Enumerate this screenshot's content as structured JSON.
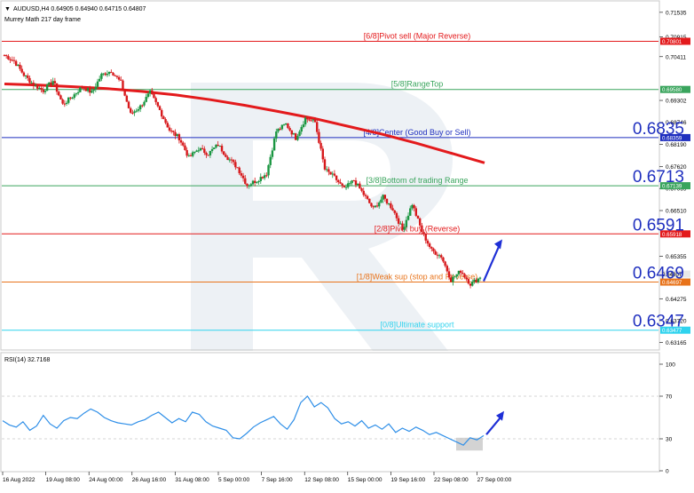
{
  "header": {
    "symbol_line": "AUDUSD,H4  0.64905 0.64940 0.64715 0.64807",
    "indicator_name": "Murrey Math 217 day frame"
  },
  "colors": {
    "bull": "#1a9641",
    "bear": "#d7191c",
    "ma": "#e31a1c",
    "rsi": "#2f8fe8",
    "arrow": "#1e2fd6",
    "watermark": "#dfe6ec"
  },
  "chart_data": [
    {
      "type": "candlestick",
      "title": "",
      "y_axis_ticks": [
        "0.71535",
        "0.70915",
        "0.70411",
        "0.69302",
        "0.68746",
        "0.68190",
        "0.67620",
        "0.67069",
        "0.66510",
        "0.65355",
        "0.64275",
        "0.63720",
        "0.63165"
      ],
      "ylim": [
        0.6302,
        0.7178
      ],
      "x_tick_labels": [
        "16 Aug 2022",
        "19 Aug 08:00",
        "24 Aug 00:00",
        "26 Aug 16:00",
        "31 Aug 08:00",
        "5 Sep 00:00",
        "7 Sep 16:00",
        "12 Sep 08:00",
        "15 Sep 00:00",
        "19 Sep 16:00",
        "22 Sep 08:00",
        "27 Sep 00:00"
      ],
      "murrey_levels": [
        {
          "label": "[6/8]Pivot sell (Major Reverse)",
          "value": 0.70801,
          "axis_badge": "0.70801",
          "big_label": "",
          "color": "#e31a1c"
        },
        {
          "label": "[5/8]RangeTop",
          "value": 0.6958,
          "axis_badge": "0.69580",
          "big_label": "",
          "color": "#3aa55d"
        },
        {
          "label": "[4/8]Center (Good Buy or Sell)",
          "value": 0.68359,
          "axis_badge": "0.68359",
          "big_label": "0.6835",
          "color": "#1f2fbf"
        },
        {
          "label": "[3/8]Bottom of trading Range",
          "value": 0.67139,
          "axis_badge": "0.67139",
          "big_label": "0.6713",
          "color": "#3aa55d"
        },
        {
          "label": "[2/8]Pivot buy (Reverse)",
          "value": 0.65918,
          "axis_badge": "0.65918",
          "big_label": "0.6591",
          "color": "#e31a1c"
        },
        {
          "label": "[1/8]Weak sup (stop and Reverse)",
          "value": 0.64697,
          "axis_badge": "0.64697",
          "big_label": "0.6469",
          "color": "#e8731a"
        },
        {
          "label": "[0/8]Ultimate support",
          "value": 0.63477,
          "axis_badge": "0.63477",
          "big_label": "0.6347",
          "color": "#2fd3ee"
        }
      ],
      "current_price_badge": "0.64807",
      "current_price": 0.64807,
      "price_path": [
        0.7045,
        0.703,
        0.6995,
        0.697,
        0.6955,
        0.698,
        0.692,
        0.694,
        0.6965,
        0.695,
        0.6995,
        0.7005,
        0.6975,
        0.6895,
        0.6915,
        0.695,
        0.6905,
        0.6855,
        0.6835,
        0.6785,
        0.6808,
        0.6795,
        0.6818,
        0.6785,
        0.676,
        0.6715,
        0.6728,
        0.6745,
        0.6852,
        0.687,
        0.6835,
        0.6885,
        0.6875,
        0.6755,
        0.6735,
        0.6705,
        0.6728,
        0.6692,
        0.6655,
        0.6685,
        0.6655,
        0.6602,
        0.6668,
        0.6598,
        0.655,
        0.6535,
        0.6475,
        0.6498,
        0.6465,
        0.6481
      ],
      "moving_average": [
        0.6972,
        0.6969,
        0.6965,
        0.696,
        0.6953,
        0.6944,
        0.6932,
        0.6918,
        0.6902,
        0.6885,
        0.6865,
        0.6845,
        0.6822,
        0.6797,
        0.6772
      ],
      "arrow": {
        "from": 0.6472,
        "to": 0.6578
      }
    },
    {
      "type": "line",
      "title": "RSI(14) 32.7168",
      "y_axis_ticks": [
        "100",
        "70",
        "30",
        "0"
      ],
      "ylim": [
        0,
        100
      ],
      "hlines": [
        70,
        30
      ],
      "values": [
        47,
        43,
        41,
        46,
        38,
        42,
        52,
        44,
        40,
        47,
        50,
        49,
        54,
        58,
        55,
        50,
        47,
        45,
        44,
        43,
        46,
        48,
        52,
        55,
        50,
        45,
        49,
        46,
        55,
        53,
        46,
        42,
        40,
        38,
        31,
        30,
        35,
        41,
        45,
        48,
        51,
        44,
        39,
        48,
        64,
        70,
        60,
        64,
        59,
        49
      ],
      "values_tail": [
        44,
        46,
        42,
        47,
        40,
        43,
        39,
        44,
        36,
        40,
        37,
        41,
        38,
        34,
        36,
        33,
        30,
        27,
        24,
        31,
        29,
        33
      ],
      "arrow": {
        "from": 34,
        "to": 56
      }
    }
  ]
}
